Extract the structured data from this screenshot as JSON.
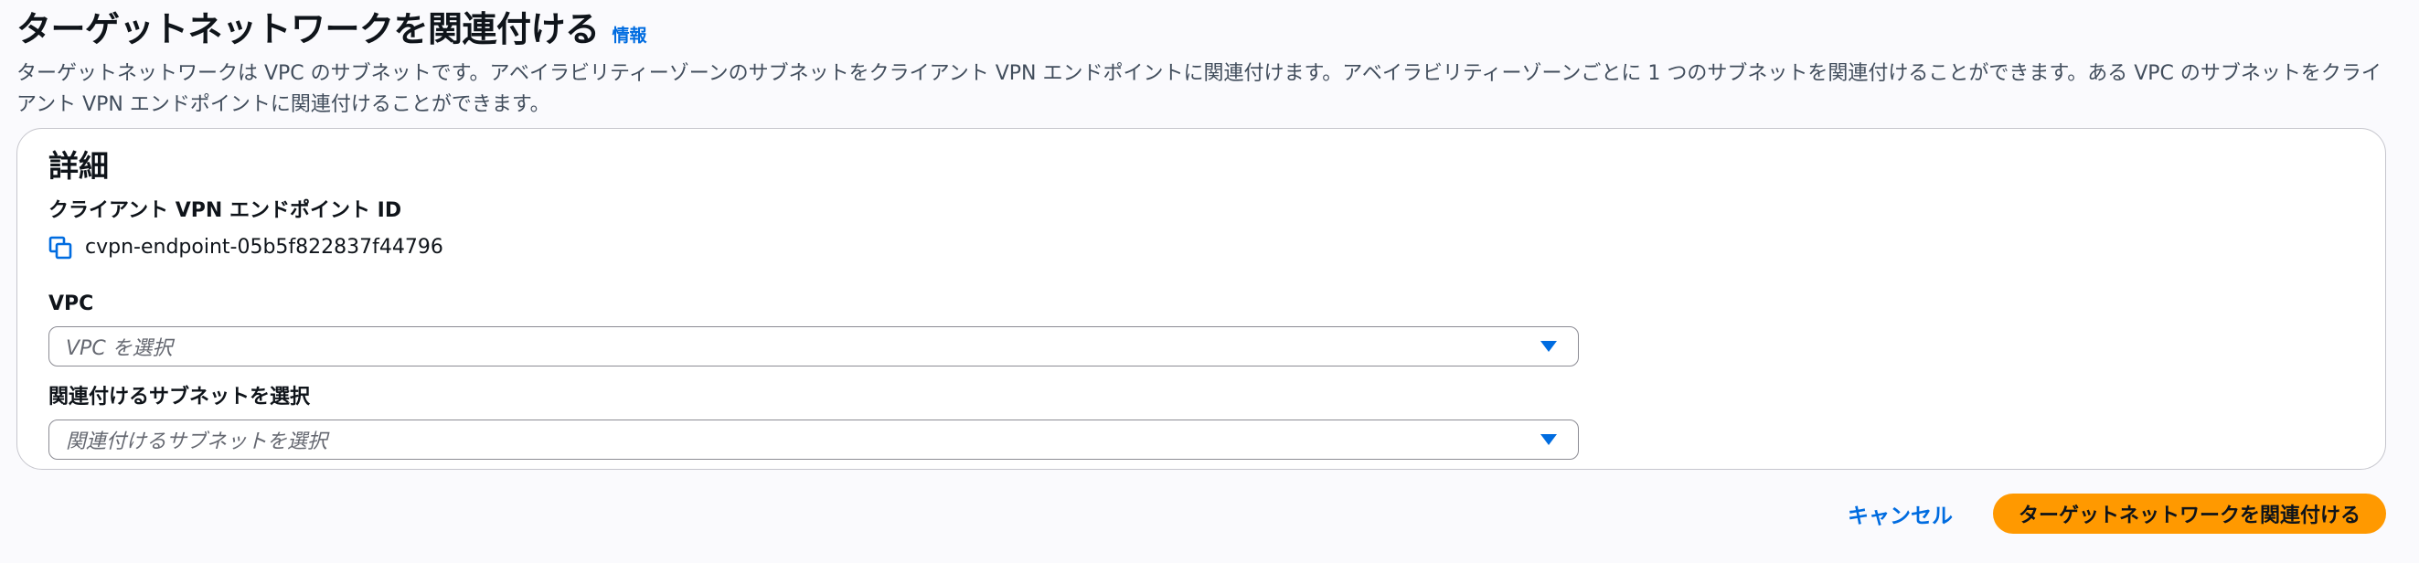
{
  "header": {
    "title": "ターゲットネットワークを関連付ける",
    "info_link": "情報",
    "description": "ターゲットネットワークは VPC のサブネットです。アベイラビリティーゾーンのサブネットをクライアント VPN エンドポイントに関連付けます。アベイラビリティーゾーンごとに 1 つのサブネットを関連付けることができます。ある VPC のサブネットをクライアント VPN エンドポイントに関連付けることができます。"
  },
  "details": {
    "title": "詳細",
    "endpoint_label": "クライアント VPN エンドポイント ID",
    "endpoint_value": "cvpn-endpoint-05b5f822837f44796",
    "endpoint_icon": "copy-icon",
    "vpc_label": "VPC",
    "vpc_placeholder": "VPC を選択",
    "subnet_label": "関連付けるサブネットを選択",
    "subnet_placeholder": "関連付けるサブネットを選択"
  },
  "actions": {
    "cancel_label": "キャンセル",
    "submit_label": "ターゲットネットワークを関連付ける"
  },
  "colors": {
    "accent": "#006ce0",
    "primary_button": "#ff9900",
    "background": "#fafafd"
  }
}
